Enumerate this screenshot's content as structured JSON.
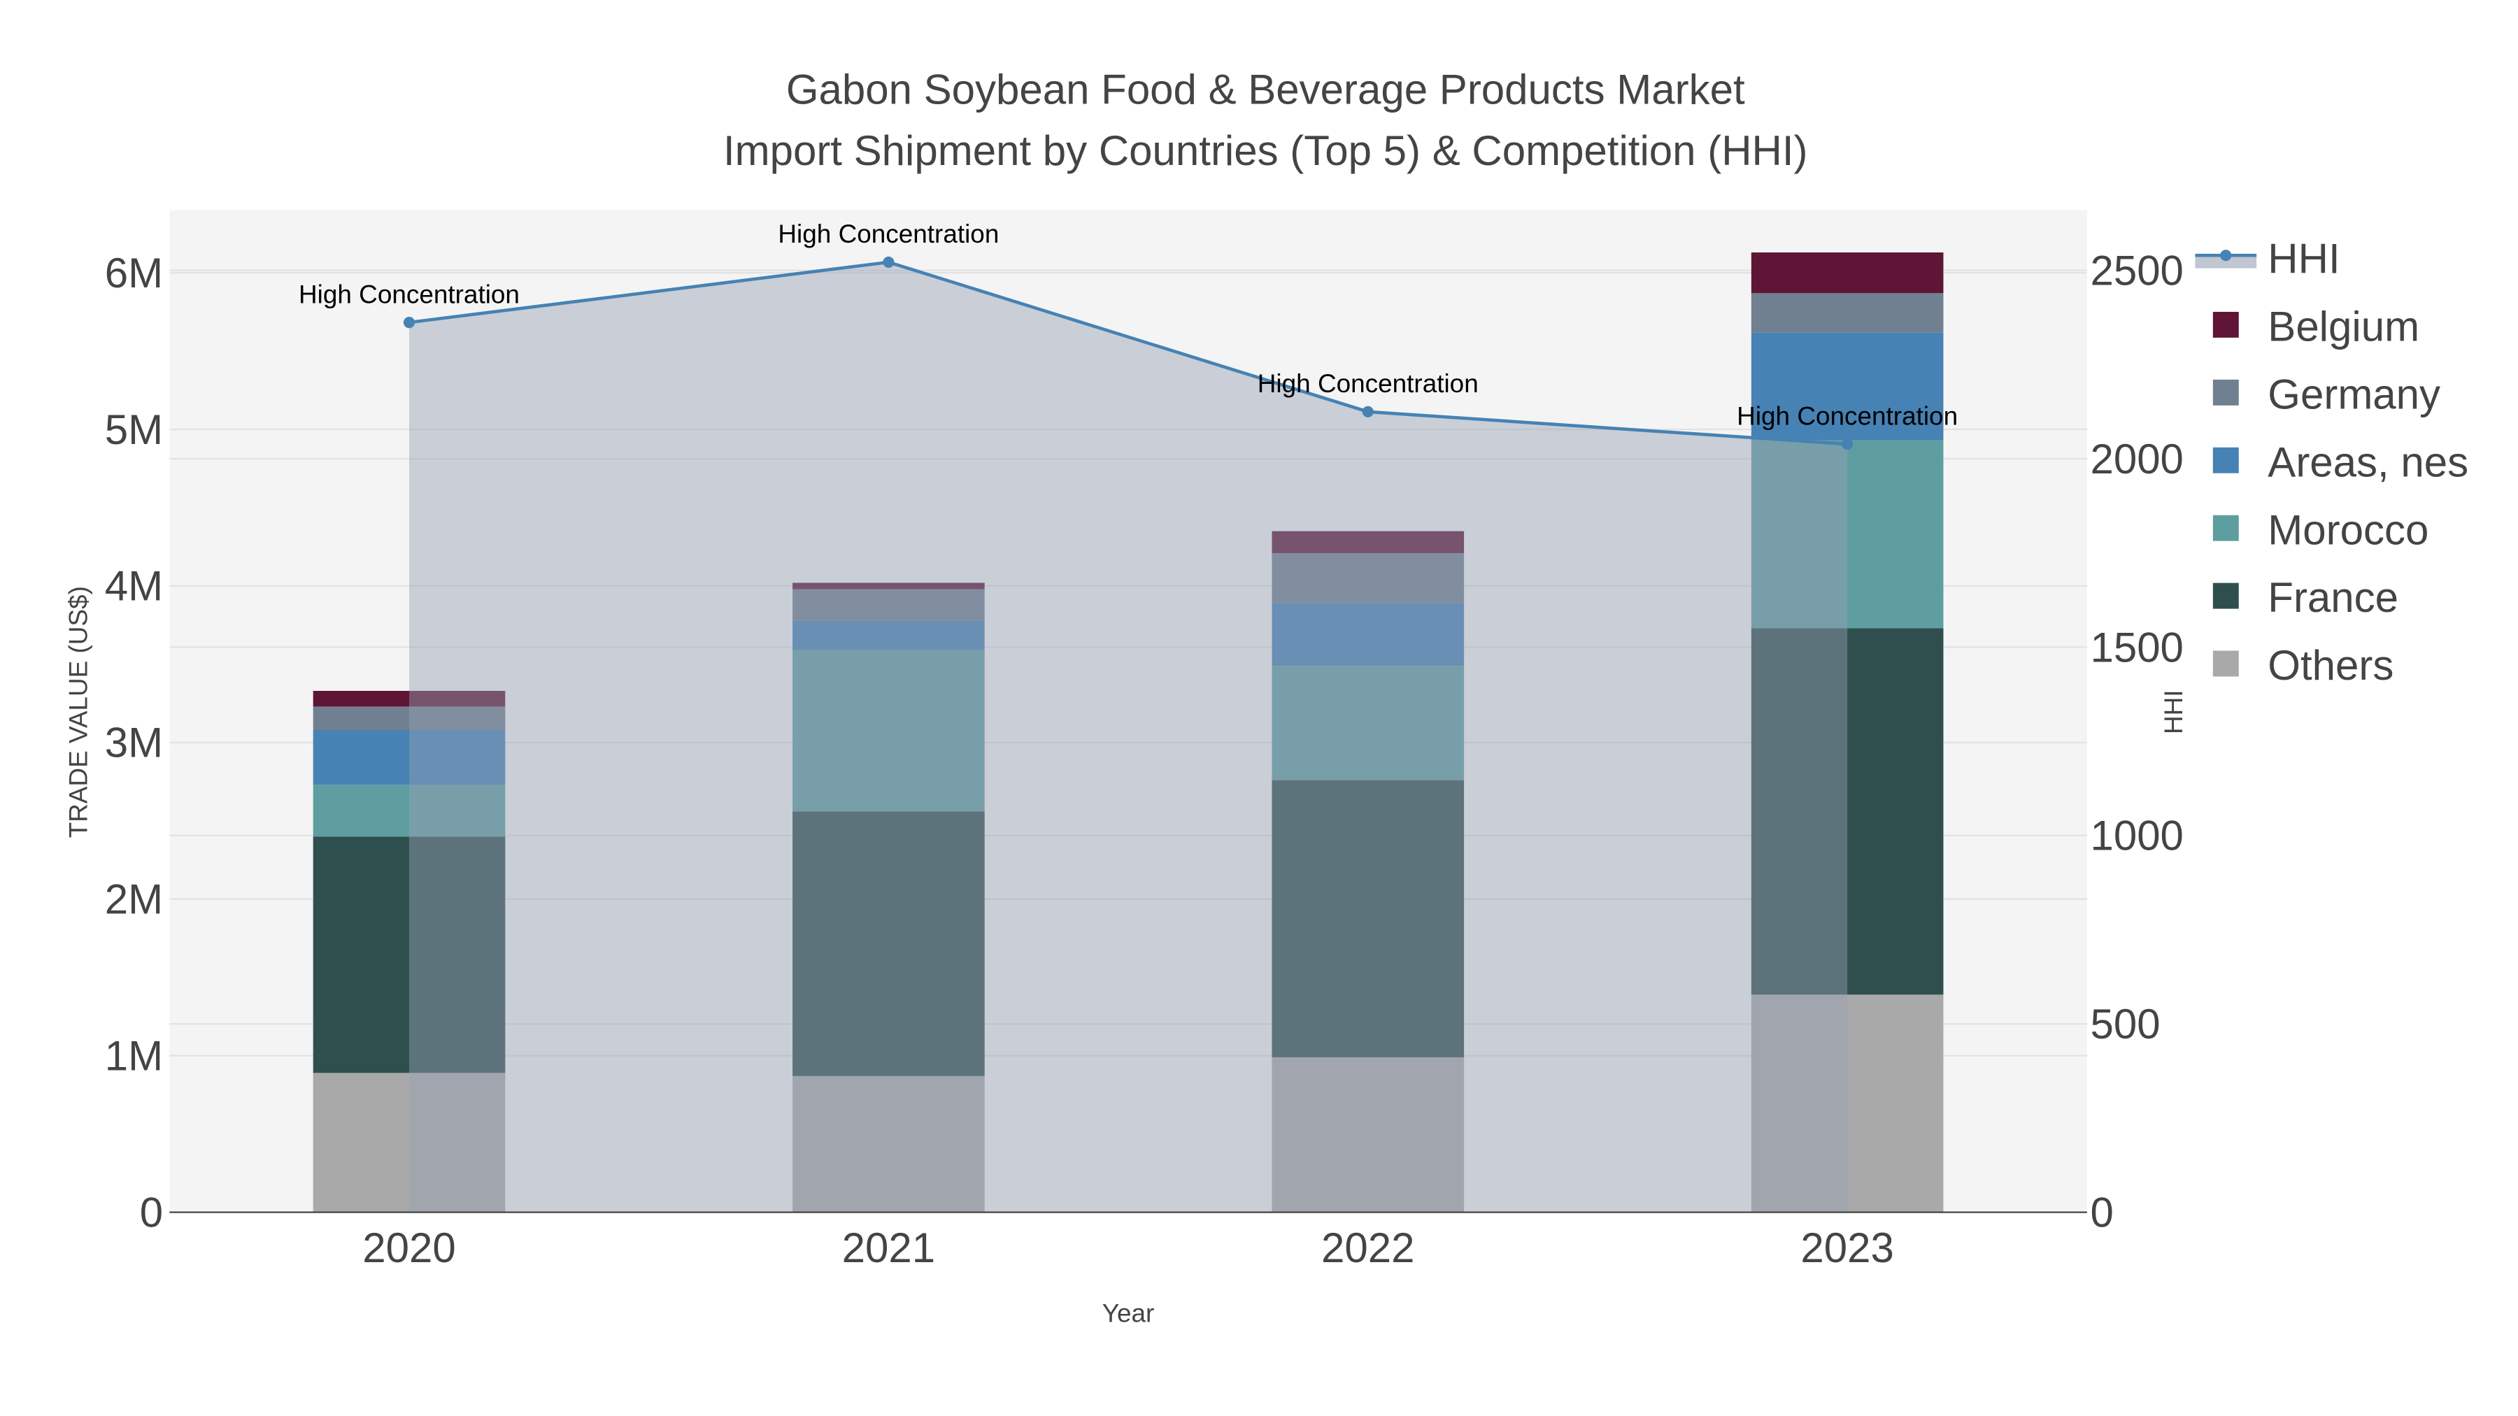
{
  "chart_data": {
    "type": "bar",
    "stacked": true,
    "title_line1": "Gabon Soybean Food & Beverage Products Market",
    "title_line2": "Import Shipment by Countries (Top 5) & Competition (HHI)",
    "xlabel": "Year",
    "ylabel": "TRADE VALUE (US$)",
    "y2label": "HHI",
    "categories": [
      "2020",
      "2021",
      "2022",
      "2023"
    ],
    "ylim": [
      0,
      6400000
    ],
    "y2lim": [
      0,
      2660
    ],
    "yticks": [
      0,
      1000000,
      2000000,
      3000000,
      4000000,
      5000000,
      6000000
    ],
    "ytick_labels": [
      "0",
      "1M",
      "2M",
      "3M",
      "4M",
      "5M",
      "6M"
    ],
    "y2ticks": [
      0,
      500,
      1000,
      1500,
      2000,
      2500
    ],
    "y2tick_labels": [
      "0",
      "500",
      "1000",
      "1500",
      "2000",
      "2500"
    ],
    "series": [
      {
        "name": "Others",
        "color": "#a9a9a9",
        "values": [
          890000,
          870000,
          990000,
          1390000
        ]
      },
      {
        "name": "France",
        "color": "#2f4f4f",
        "values": [
          1510000,
          1690000,
          1770000,
          2340000
        ]
      },
      {
        "name": "Morocco",
        "color": "#5f9ea0",
        "values": [
          330000,
          1030000,
          730000,
          1200000
        ]
      },
      {
        "name": "Areas, nes",
        "color": "#4682b4",
        "values": [
          350000,
          190000,
          400000,
          690000
        ]
      },
      {
        "name": "Germany",
        "color": "#708090",
        "values": [
          150000,
          200000,
          320000,
          250000
        ]
      },
      {
        "name": "Belgium",
        "color": "#5e1536",
        "values": [
          100000,
          40000,
          140000,
          260000
        ]
      }
    ],
    "hhi": {
      "name": "HHI",
      "color": "#4682b4",
      "values": [
        2362,
        2522,
        2125,
        2039
      ],
      "annotations": [
        "High Concentration",
        "High Concentration",
        "High Concentration",
        "High Concentration"
      ]
    },
    "legend_order": [
      "HHI",
      "Belgium",
      "Germany",
      "Areas, nes",
      "Morocco",
      "France",
      "Others"
    ],
    "legend_position": "right",
    "grid": true
  }
}
